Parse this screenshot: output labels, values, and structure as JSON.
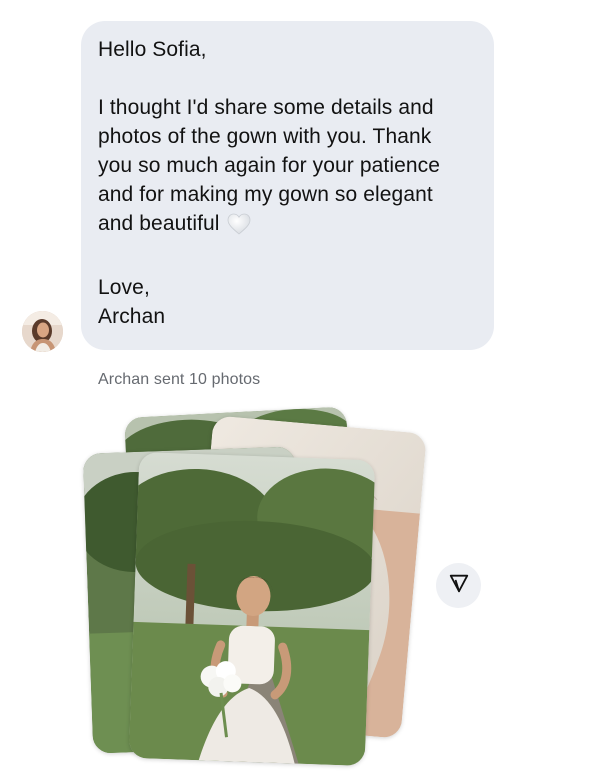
{
  "message": {
    "greeting": "Hello Sofia,",
    "body_lines": [
      "I thought I'd share some details and",
      "photos of the gown with you. Thank",
      "you so much again for your patience",
      "and for making my gown so elegant",
      "and beautiful"
    ],
    "signoff": "Love,",
    "signature": "Archan"
  },
  "photos_caption": "Archan sent 10 photos",
  "icons": {
    "heart": "white-heart-icon",
    "share": "send-icon",
    "avatar": "avatar"
  },
  "colors": {
    "bubble": "#e9ecf2",
    "text": "#121212",
    "meta": "#666a70",
    "share_button": "#eef0f4"
  }
}
